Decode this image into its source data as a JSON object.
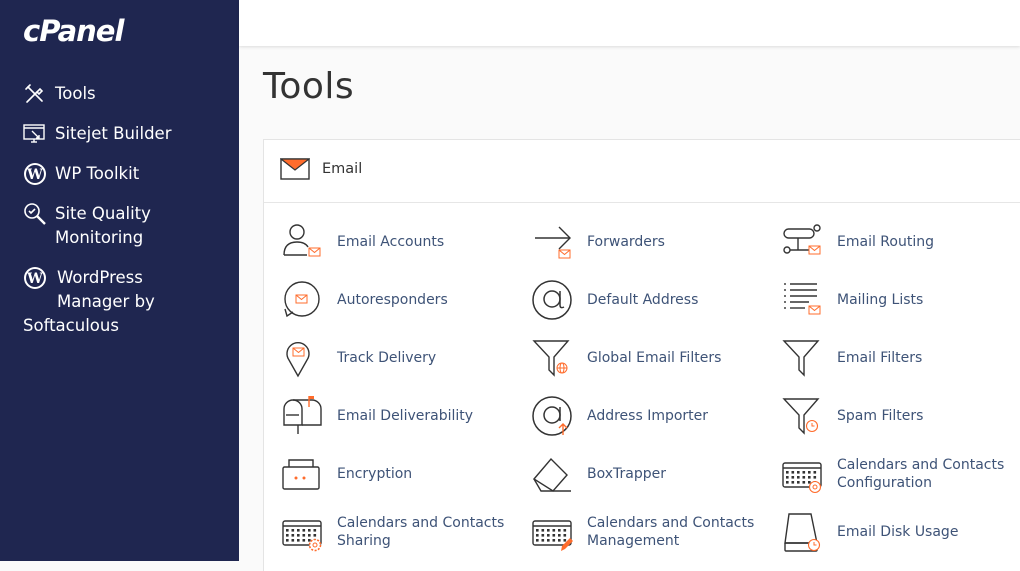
{
  "app": {
    "logo_text": "cPanel"
  },
  "sidebar": {
    "items": [
      {
        "lines": [
          "Tools"
        ],
        "icon": "tools-icon"
      },
      {
        "lines": [
          "Sitejet Builder"
        ],
        "icon": "sitejet-icon"
      },
      {
        "lines": [
          "WP Toolkit"
        ],
        "icon": "wordpress-icon"
      },
      {
        "lines": [
          "Site Quality",
          "Monitoring"
        ],
        "icon": "magnifier-icon"
      },
      {
        "lines": [
          "WordPress",
          "Manager by",
          "Softaculous"
        ],
        "icon": "wordpress-icon"
      }
    ]
  },
  "page": {
    "title": "Tools"
  },
  "section": {
    "title": "Email",
    "icon": "envelope-icon"
  },
  "tools": [
    {
      "label": "Email Accounts",
      "icon": "user-mail-icon"
    },
    {
      "label": "Forwarders",
      "icon": "forward-arrow-icon"
    },
    {
      "label": "Email Routing",
      "icon": "routing-icon"
    },
    {
      "label": "Autoresponders",
      "icon": "auto-reply-icon"
    },
    {
      "label": "Default Address",
      "icon": "at-sign-icon"
    },
    {
      "label": "Mailing Lists",
      "icon": "list-mail-icon"
    },
    {
      "label": "Track Delivery",
      "icon": "location-pin-icon"
    },
    {
      "label": "Global Email Filters",
      "icon": "funnel-globe-icon"
    },
    {
      "label": "Email Filters",
      "icon": "funnel-icon"
    },
    {
      "label": "Email Deliverability",
      "icon": "mailbox-icon"
    },
    {
      "label": "Address Importer",
      "icon": "at-import-icon"
    },
    {
      "label": "Spam Filters",
      "icon": "funnel-clock-icon"
    },
    {
      "label": "Encryption",
      "icon": "briefcase-icon"
    },
    {
      "label": "BoxTrapper",
      "icon": "box-trap-icon"
    },
    {
      "label": "Calendars and Contacts Configuration",
      "icon": "calendar-at-icon"
    },
    {
      "label": "Calendars and Contacts Sharing",
      "icon": "calendar-gear-icon"
    },
    {
      "label": "Calendars and Contacts Management",
      "icon": "calendar-pencil-icon"
    },
    {
      "label": "Email Disk Usage",
      "icon": "disk-usage-icon"
    }
  ],
  "colors": {
    "sidebar": "#1f2650",
    "accent": "#ff6c2c",
    "link": "#3e5377"
  }
}
